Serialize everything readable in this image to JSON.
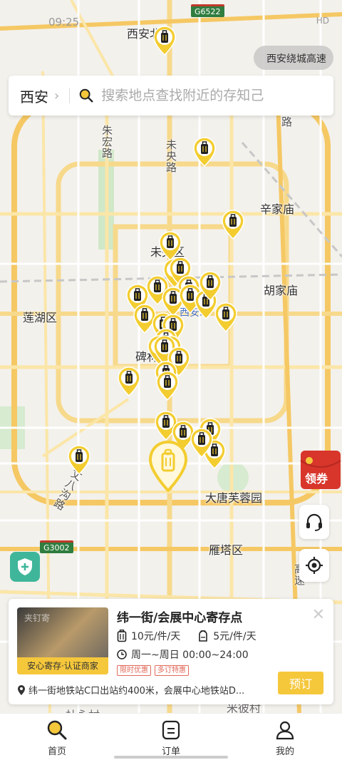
{
  "status_bar": {
    "time": "09:25",
    "right": "HD"
  },
  "search": {
    "city": "西安",
    "placeholder": "搜索地点查找附近的存知己"
  },
  "ring_chip": {
    "label": "西安绕城高速"
  },
  "map": {
    "labels": {
      "top_station": "西安北站",
      "weiyang_district": "未央区",
      "lianhu_district": "莲湖区",
      "beilin": "碑林",
      "xinjia_temple": "辛家庙",
      "hujia_temple": "胡家庙",
      "xian_station": "西安站",
      "datang_furong": "大唐芙蓉园",
      "yanta_district": "雁塔区",
      "zhuhong_road": "朱宏路",
      "weiyang_road": "未央路",
      "zhangbagou": "丈八沟路",
      "gaosu": "高速",
      "bottom_text": "杜永村",
      "bottom_text2": "米彼村",
      "lu": "路"
    },
    "shields": {
      "g6522": "G6522",
      "g3002": "G3002"
    }
  },
  "coupon": {
    "label": "领券"
  },
  "card": {
    "title": "纬一街/会展中心寄存点",
    "thumb_text": "夹钉寄",
    "badge": "安心寄存·认证商家",
    "price_large": "10元/件/天",
    "price_small": "5元/件/天",
    "hours": "周一~周日 00:00~24:00",
    "tags": [
      "限时优惠",
      "多订特惠"
    ],
    "reserve_label": "预订",
    "address": "纬一街地铁站C口出站约400米，会展中心地铁站D..."
  },
  "nav": [
    {
      "label": "首页"
    },
    {
      "label": "订单"
    },
    {
      "label": "我的"
    }
  ]
}
